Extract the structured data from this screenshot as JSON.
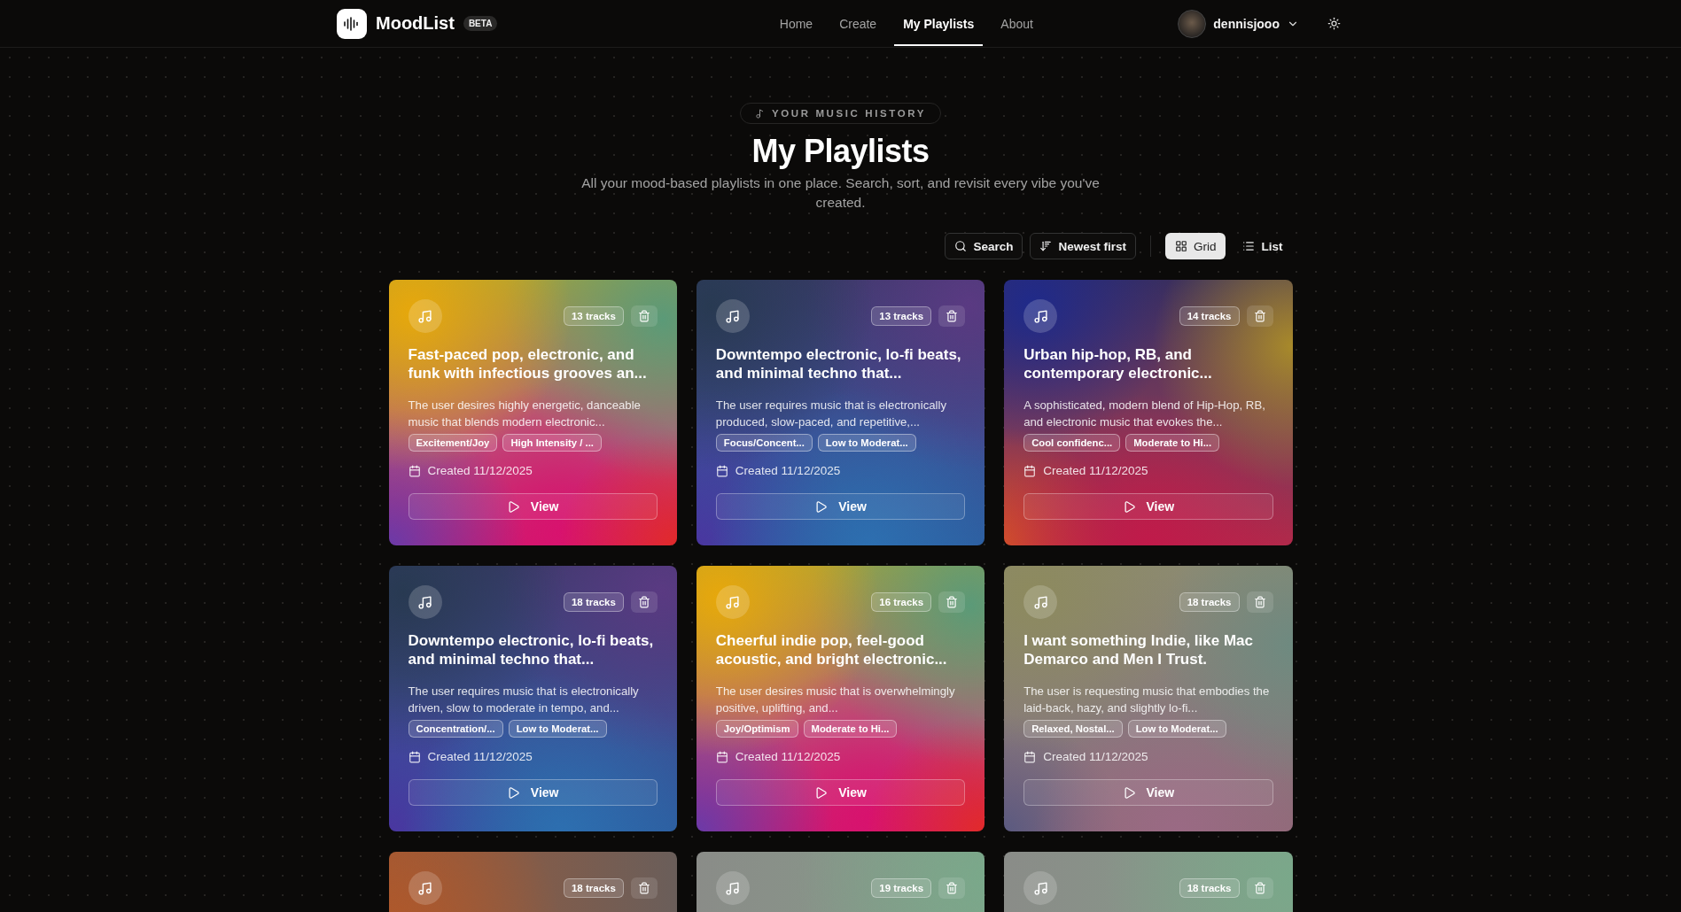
{
  "header": {
    "brand": "MoodList",
    "badge": "BETA",
    "nav": [
      {
        "label": "Home",
        "selected": false
      },
      {
        "label": "Create",
        "selected": false
      },
      {
        "label": "My Playlists",
        "selected": true
      },
      {
        "label": "About",
        "selected": false
      }
    ],
    "user": {
      "name": "dennisjooo"
    }
  },
  "hero": {
    "eyebrow": "YOUR MUSIC HISTORY",
    "title": "My Playlists",
    "subtitle": "All your mood-based playlists in one place. Search, sort, and revisit every vibe you've created."
  },
  "toolbar": {
    "search": "Search",
    "sort": "Newest first",
    "views": [
      {
        "label": "Grid",
        "kind": "grid",
        "selected": true
      },
      {
        "label": "List",
        "kind": "list",
        "selected": false
      }
    ]
  },
  "playlists": [
    {
      "kind": "sunset",
      "tracks": "13 tracks",
      "title": "Fast-paced pop, electronic, and funk with infectious grooves an...",
      "description": "The user desires highly energetic, danceable music that blends modern electronic...",
      "tags": [
        "Excitement/Joy",
        "High Intensity / ..."
      ],
      "created": "Created 11/12/2025",
      "action": "View"
    },
    {
      "kind": "ocean",
      "tracks": "13 tracks",
      "title": "Downtempo electronic, lo-fi beats, and minimal techno that...",
      "description": "The user requires music that is electronically produced, slow-paced, and repetitive,...",
      "tags": [
        "Focus/Concent...",
        "Low to Moderat..."
      ],
      "created": "Created 11/12/2025",
      "action": "View"
    },
    {
      "kind": "dusk",
      "tracks": "14 tracks",
      "title": "Urban hip-hop, RB, and contemporary electronic...",
      "description": "A sophisticated, modern blend of Hip-Hop, RB, and electronic music that evokes the...",
      "tags": [
        "Cool confidenc...",
        "Moderate to Hi..."
      ],
      "created": "Created 11/12/2025",
      "action": "View"
    },
    {
      "kind": "ocean",
      "tracks": "18 tracks",
      "title": "Downtempo electronic, lo-fi beats, and minimal techno that...",
      "description": "The user requires music that is electronically driven, slow to moderate in tempo, and...",
      "tags": [
        "Concentration/...",
        "Low to Moderat..."
      ],
      "created": "Created 11/12/2025",
      "action": "View"
    },
    {
      "kind": "sunset",
      "tracks": "16 tracks",
      "title": "Cheerful indie pop, feel-good acoustic, and bright electronic...",
      "description": "The user desires music that is overwhelmingly positive, uplifting, and...",
      "tags": [
        "Joy/Optimism",
        "Moderate to Hi..."
      ],
      "created": "Created 11/12/2025",
      "action": "View"
    },
    {
      "kind": "sage",
      "tracks": "18 tracks",
      "title": "I want something Indie, like Mac Demarco and Men I Trust.",
      "description": "The user is requesting music that embodies the laid-back, hazy, and slightly lo-fi...",
      "tags": [
        "Relaxed, Nostal...",
        "Low to Moderat..."
      ],
      "created": "Created 11/12/2025",
      "action": "View"
    },
    {
      "kind": "rust",
      "tracks": "18 tracks"
    },
    {
      "kind": "mint",
      "tracks": "19 tracks"
    },
    {
      "kind": "mint",
      "tracks": "18 tracks"
    }
  ]
}
